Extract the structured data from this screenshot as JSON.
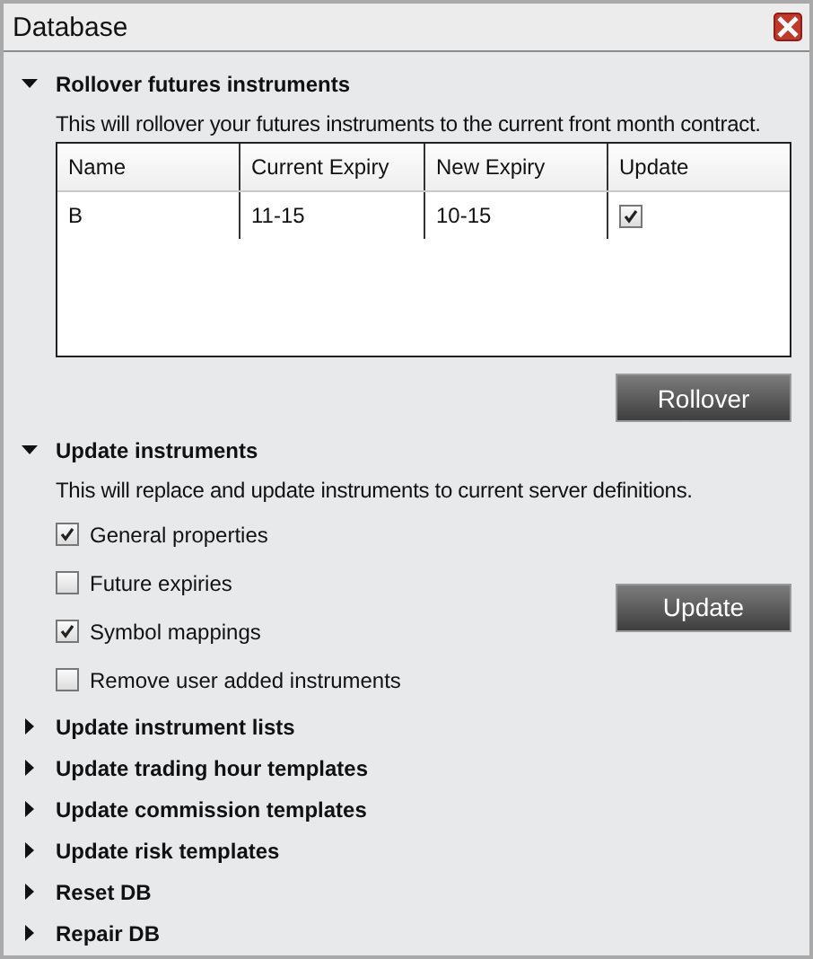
{
  "window": {
    "title": "Database"
  },
  "sections": [
    {
      "title": "Rollover futures instruments",
      "expanded": true,
      "kind": "table",
      "description": "This will rollover your futures instruments to the current front month contract.",
      "table": {
        "columns": [
          "Name",
          "Current Expiry",
          "New Expiry",
          "Update"
        ],
        "rows": [
          {
            "cells": [
              "B",
              "11-15",
              "10-15"
            ],
            "checked": true
          }
        ]
      },
      "button": "Rollover"
    },
    {
      "title": "Update instruments",
      "expanded": true,
      "kind": "options",
      "description": "This will replace and update instruments to current server definitions.",
      "options": [
        {
          "label": "General properties",
          "checked": true
        },
        {
          "label": "Future expiries",
          "checked": false
        },
        {
          "label": "Symbol mappings",
          "checked": true
        },
        {
          "label": "Remove user added instruments",
          "checked": false
        }
      ],
      "button": "Update"
    },
    {
      "title": "Update instrument lists",
      "expanded": false
    },
    {
      "title": "Update trading hour templates",
      "expanded": false
    },
    {
      "title": "Update commission templates",
      "expanded": false
    },
    {
      "title": "Update risk templates",
      "expanded": false
    },
    {
      "title": "Reset DB",
      "expanded": false
    },
    {
      "title": "Repair DB",
      "expanded": false
    }
  ]
}
